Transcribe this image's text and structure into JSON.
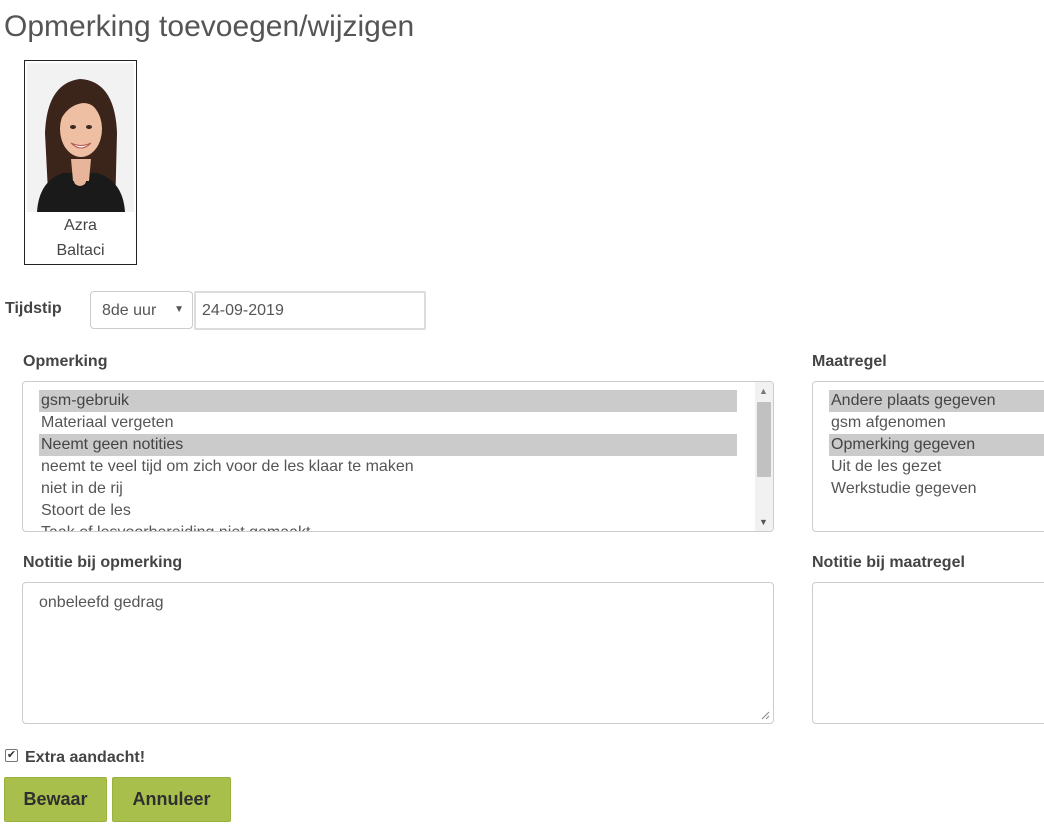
{
  "page": {
    "title": "Opmerking toevoegen/wijzigen"
  },
  "student": {
    "first_name": "Azra",
    "last_name": "Baltaci"
  },
  "tijdstip": {
    "label": "Tijdstip",
    "hour_selected": "8de uur",
    "date_value": "24-09-2019"
  },
  "opmerking": {
    "label": "Opmerking",
    "options": [
      {
        "text": "gsm-gebruik",
        "selected": true
      },
      {
        "text": "Materiaal vergeten",
        "selected": false
      },
      {
        "text": "Neemt geen notities",
        "selected": true
      },
      {
        "text": "neemt te veel tijd om zich voor de les klaar te maken",
        "selected": false
      },
      {
        "text": "niet in de rij",
        "selected": false
      },
      {
        "text": "Stoort de les",
        "selected": false
      },
      {
        "text": "Taak of lesvoorbereiding niet gemaakt",
        "selected": false
      }
    ]
  },
  "maatregel": {
    "label": "Maatregel",
    "options": [
      {
        "text": "Andere plaats gegeven",
        "selected": true
      },
      {
        "text": "gsm afgenomen",
        "selected": false
      },
      {
        "text": "Opmerking gegeven",
        "selected": true
      },
      {
        "text": "Uit de les gezet",
        "selected": false
      },
      {
        "text": "Werkstudie gegeven",
        "selected": false
      }
    ]
  },
  "notitie_opmerking": {
    "label": "Notitie bij opmerking",
    "value": "onbeleefd gedrag"
  },
  "notitie_maatregel": {
    "label": "Notitie bij maatregel",
    "value": ""
  },
  "extra_aandacht": {
    "label": "Extra aandacht!",
    "checked": true
  },
  "buttons": {
    "save_label": "Bewaar",
    "cancel_label": "Annuleer"
  }
}
